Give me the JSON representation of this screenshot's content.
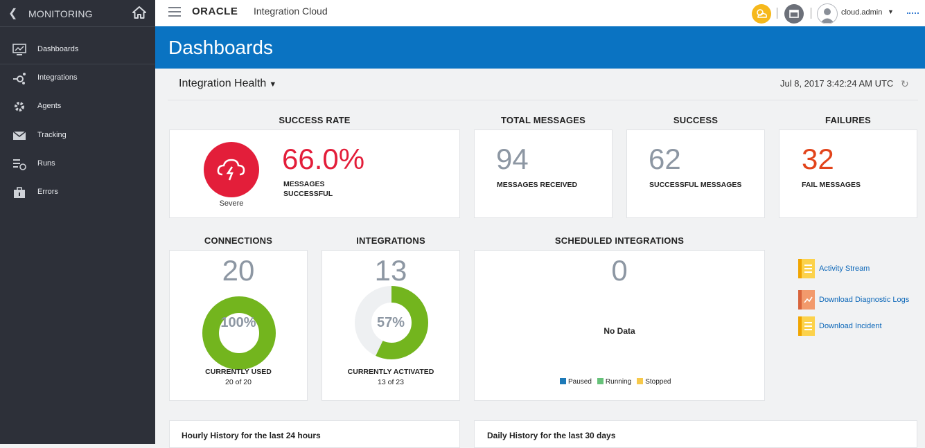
{
  "sidebar": {
    "title": "MONITORING",
    "items": [
      {
        "label": "Dashboards",
        "icon": "monitor-icon"
      },
      {
        "label": "Integrations",
        "icon": "integrations-icon"
      },
      {
        "label": "Agents",
        "icon": "gear-icon"
      },
      {
        "label": "Tracking",
        "icon": "envelope-icon"
      },
      {
        "label": "Runs",
        "icon": "runs-icon"
      },
      {
        "label": "Errors",
        "icon": "toolbox-icon"
      }
    ]
  },
  "topbar": {
    "logo": "ORACLE",
    "product": "Integration Cloud",
    "user": "cloud.admin",
    "accent": "#f6b81b"
  },
  "banner": {
    "title": "Dashboards",
    "color": "#0a73c2"
  },
  "subheader": {
    "selector": "Integration Health",
    "timestamp": "Jul 8, 2017 3:42:24 AM UTC"
  },
  "success_rate": {
    "title": "SUCCESS RATE",
    "value": "66.0%",
    "caption_line1": "MESSAGES",
    "caption_line2": "SUCCESSFUL",
    "status": "Severe",
    "status_color": "#e31e3a"
  },
  "total_messages": {
    "title": "TOTAL MESSAGES",
    "value": "94",
    "caption": "MESSAGES RECEIVED"
  },
  "success": {
    "title": "SUCCESS",
    "value": "62",
    "caption": "SUCCESSFUL MESSAGES"
  },
  "failures": {
    "title": "FAILURES",
    "value": "32",
    "caption": "FAIL MESSAGES",
    "color": "#e2441b"
  },
  "connections": {
    "title": "CONNECTIONS",
    "value": "20",
    "percent": "100%",
    "fraction": 1.0,
    "caption": "CURRENTLY USED",
    "detail": "20 of 20"
  },
  "integrations": {
    "title": "INTEGRATIONS",
    "value": "13",
    "percent": "57%",
    "fraction": 0.57,
    "caption": "CURRENTLY ACTIVATED",
    "detail": "13 of 23"
  },
  "scheduled": {
    "title": "SCHEDULED INTEGRATIONS",
    "value": "0",
    "empty": "No Data",
    "legend": [
      {
        "label": "Paused",
        "color": "#1e7ab8"
      },
      {
        "label": "Running",
        "color": "#67c27a"
      },
      {
        "label": "Stopped",
        "color": "#f7c94b"
      }
    ]
  },
  "links": [
    {
      "label": "Activity Stream",
      "icon": "document-icon"
    },
    {
      "label": "Download Diagnostic Logs",
      "icon": "chart-document-icon"
    },
    {
      "label": "Download Incident",
      "icon": "document-icon"
    }
  ],
  "history": {
    "hourly": "Hourly History for the last 24 hours",
    "daily": "Daily History for the last 30 days"
  },
  "donut_color": "#73b51e"
}
